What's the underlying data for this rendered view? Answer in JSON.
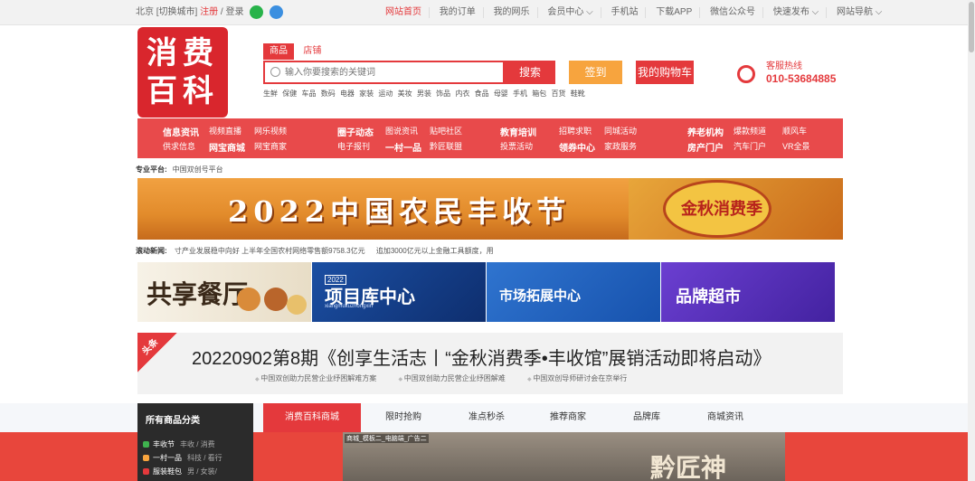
{
  "topbar": {
    "city": "北京",
    "switch_city": "[切换城市]",
    "register": "注册",
    "separator": "/",
    "login": "登录",
    "nav": [
      "网站首页",
      "我的订单",
      "我的网乐",
      "会员中心 ⌵",
      "手机站",
      "下载APP",
      "微信公众号",
      "快速发布 ⌵",
      "网站导航 ⌵"
    ]
  },
  "logo": {
    "line1": "消费",
    "line2": "百科"
  },
  "search": {
    "tab_goods": "商品",
    "tab_shops": "店铺",
    "placeholder": "输入你要搜索的关键词",
    "button": "搜索",
    "hot_words": [
      "生鲜",
      "保健",
      "车品",
      "数码",
      "电器",
      "家装",
      "运动",
      "美妆",
      "男装",
      "饰品",
      "内衣",
      "食品",
      "母婴",
      "手机",
      "箱包",
      "百货",
      "鞋靴"
    ]
  },
  "signin_label": "签到",
  "cart_label": "我的购物车",
  "hotline": {
    "label": "客服热线",
    "number": "010-53684885"
  },
  "channels": {
    "row1": [
      "信息资讯",
      "视频直播",
      "网乐视频",
      "圈子动态",
      "图说资讯",
      "贴吧社区",
      "教育培训",
      "招聘求职",
      "同城活动",
      "养老机构",
      "爆款频道",
      "顺风车"
    ],
    "row2": [
      "供求信息",
      "网宝商城",
      "网宝商家",
      "电子报刊",
      "一村一品",
      "黔匠联盟",
      "投票活动",
      "领券中心",
      "家政服务",
      "房产门户",
      "汽车门户",
      "VR全景"
    ]
  },
  "platform": {
    "label": "专业平台:",
    "value": "中国双创号平台"
  },
  "banners": {
    "harvest": "2022中国农民丰收节",
    "autumn": "金秋消费季"
  },
  "ticker": {
    "label": "滚动新闻:",
    "items": [
      "寸产业发展稳中向好 上半年全国农村网络零售额9758.3亿元",
      "追加3000亿元以上金融工具额度，用"
    ]
  },
  "tiles": {
    "t1": "共享餐厅",
    "t2": "项目库中心",
    "t2_year": "2022",
    "t2_sub": "xiangmukuzhongxin",
    "t3": "市场拓展中心",
    "t4": "品牌超市"
  },
  "headline": {
    "badge": "头条",
    "title": "20220902第8期《创享生活志丨“金秋消费季•丰收馆”展销活动即将启动》",
    "subs": [
      "中国双创助力民营企业纾困解难方案",
      "中国双创助力民营企业纾困解难",
      "中国双创导师研讨会在京举行"
    ]
  },
  "categories": {
    "title": "所有商品分类",
    "items": [
      {
        "name": "丰收节",
        "sub": "丰收 / 消费",
        "color": "#3fb34f"
      },
      {
        "name": "一村一品",
        "sub": "科技 / 看行",
        "color": "#f7a43e"
      },
      {
        "name": "服装鞋包",
        "sub": "男 / 女装/",
        "color": "#e4393c"
      }
    ]
  },
  "tabs": [
    "消费百科商城",
    "限时抢购",
    "准点秒杀",
    "推荐商家",
    "品牌库",
    "商城资讯"
  ],
  "ad": {
    "label": "商城_模板二_电脑端_广告二",
    "brand": "黔匠神"
  },
  "colors": {
    "primary": "#e4393c",
    "orange": "#f7a43e",
    "channel_bg": "#e84a4b"
  }
}
